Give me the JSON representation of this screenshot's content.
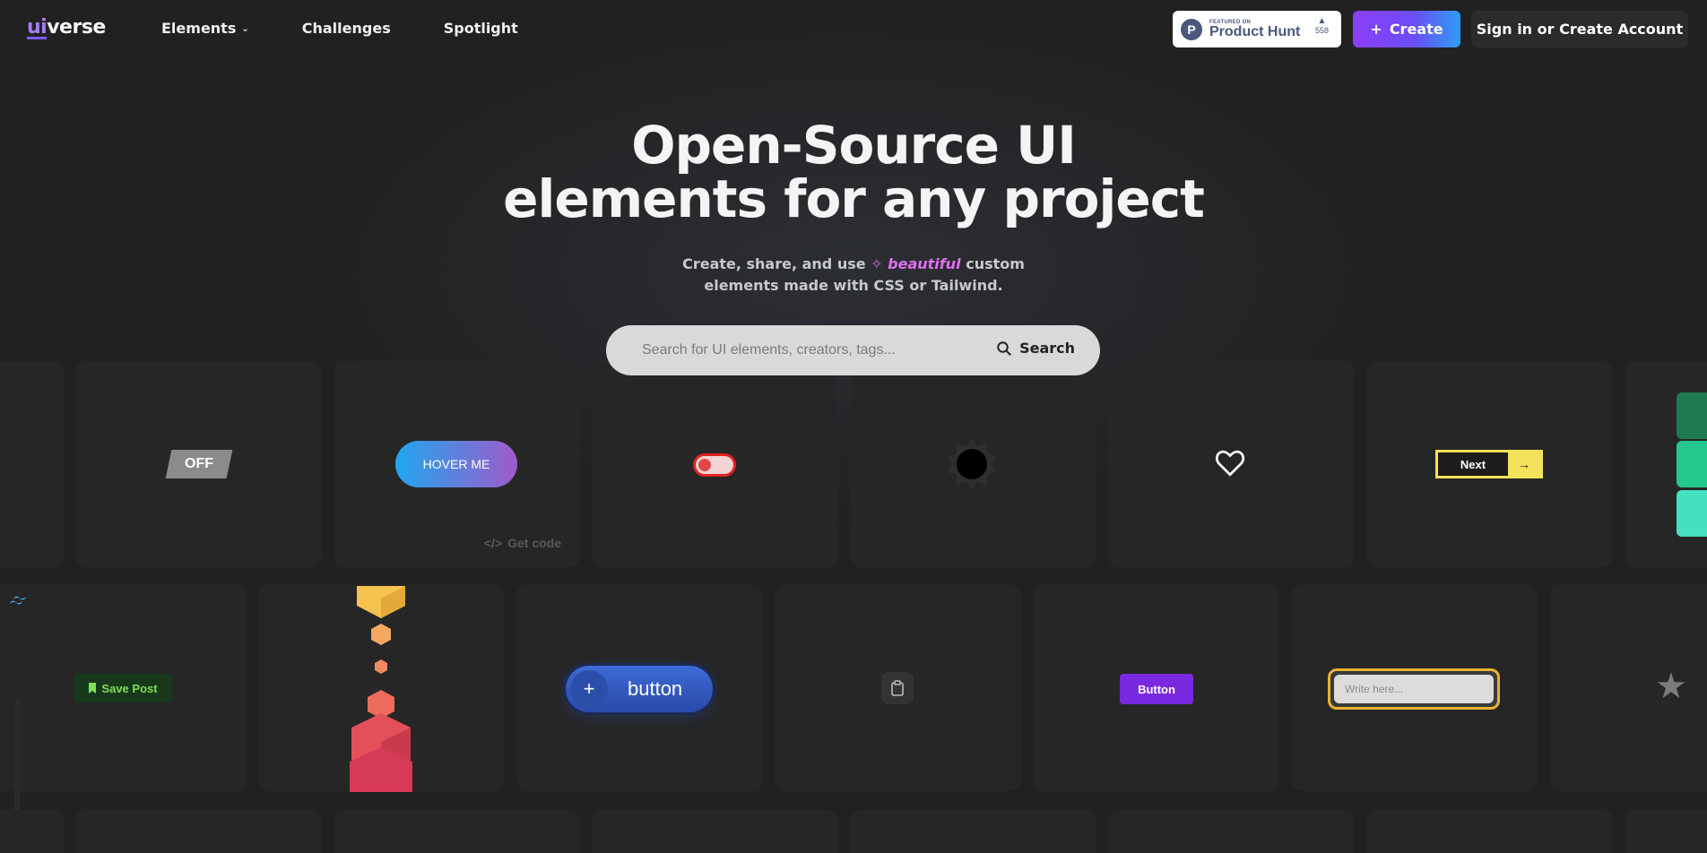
{
  "header": {
    "logo_ui": "ui",
    "logo_rest": "verse",
    "nav": [
      {
        "label": "Elements",
        "has_chevron": true
      },
      {
        "label": "Challenges",
        "has_chevron": false
      },
      {
        "label": "Spotlight",
        "has_chevron": false
      }
    ],
    "product_hunt": {
      "featured": "FEATURED ON",
      "name": "Product Hunt",
      "votes": "558"
    },
    "create_label": "Create",
    "signin_label": "Sign in or Create Account"
  },
  "hero": {
    "title_line1": "Open-Source UI",
    "title_line2": "elements for any project",
    "sub_pre": "Create, share, and use",
    "sub_highlight": "beautiful",
    "sub_post": "custom",
    "sub_line2": "elements made with CSS or Tailwind."
  },
  "search": {
    "placeholder": "Search for UI elements, creators, tags...",
    "button_label": "Search"
  },
  "cards_row1": {
    "off_label": "OFF",
    "hover_label": "HOVER ME",
    "get_code": "Get code",
    "next_label": "Next"
  },
  "cards_row2": {
    "save_post": "Save Post",
    "button_label": "button",
    "purple_button": "Button",
    "write_placeholder": "Write here..."
  },
  "colors": {
    "accent_purple": "#8a3ffc",
    "accent_blue": "#2f9cf5",
    "background": "#212121",
    "card": "#262626"
  }
}
